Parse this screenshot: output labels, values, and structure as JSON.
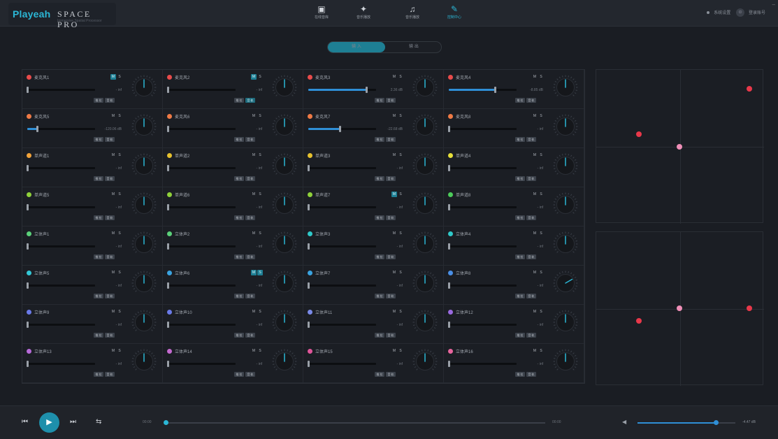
{
  "header": {
    "brand": "Playeah",
    "product": "SPACE  PRO",
    "tagline": "Immersive Spatial Processor",
    "nav": [
      {
        "label": "在线音库",
        "icon": "▣"
      },
      {
        "label": "音乐播放",
        "icon": "✦"
      },
      {
        "label": "音乐播放",
        "icon": "♫"
      },
      {
        "label": "控制中心",
        "icon": "✎"
      }
    ],
    "settings_label": "系统设置",
    "user_label": "登录账号",
    "minimize": "–"
  },
  "tabs": {
    "input": "输 入",
    "output": "输 出"
  },
  "channels": [
    {
      "name": "麦克风1",
      "color": "#e84b4b",
      "m": true,
      "s": false,
      "level": 0,
      "db": "- inf",
      "b1": false,
      "b2": false,
      "knob": 0
    },
    {
      "name": "麦克风2",
      "color": "#e84b4b",
      "m": true,
      "s": false,
      "level": 0,
      "db": "- inf",
      "b1": false,
      "b2": true,
      "knob": 0
    },
    {
      "name": "麦克风3",
      "color": "#e84b4b",
      "m": false,
      "s": false,
      "level": 0.86,
      "db": "2.36 dB",
      "b1": false,
      "b2": false,
      "knob": 0
    },
    {
      "name": "麦克风4",
      "color": "#e84b4b",
      "m": false,
      "s": false,
      "level": 0.68,
      "db": "-8.85 dB",
      "b1": false,
      "b2": false,
      "knob": 0
    },
    {
      "name": "麦克风5",
      "color": "#ef7a45",
      "m": false,
      "s": false,
      "level": 0.14,
      "db": "-120.06 dB",
      "b1": false,
      "b2": false,
      "knob": 0
    },
    {
      "name": "麦克风6",
      "color": "#ef7a45",
      "m": false,
      "s": false,
      "level": 0,
      "db": "- inf",
      "b1": false,
      "b2": false,
      "knob": 0
    },
    {
      "name": "麦克风7",
      "color": "#ef7a45",
      "m": false,
      "s": false,
      "level": 0.46,
      "db": "-22.68 dB",
      "b1": false,
      "b2": false,
      "knob": 0
    },
    {
      "name": "麦克风8",
      "color": "#ef7a45",
      "m": false,
      "s": false,
      "level": 0,
      "db": "- inf",
      "b1": false,
      "b2": false,
      "knob": 0
    },
    {
      "name": "单声道1",
      "color": "#f2a33a",
      "m": false,
      "s": false,
      "level": 0,
      "db": "- inf",
      "b1": false,
      "b2": false,
      "knob": 0
    },
    {
      "name": "单声道2",
      "color": "#e6c12f",
      "m": false,
      "s": false,
      "level": 0,
      "db": "- inf",
      "b1": false,
      "b2": false,
      "knob": 0
    },
    {
      "name": "单声道3",
      "color": "#e6c12f",
      "m": false,
      "s": false,
      "level": 0,
      "db": "- inf",
      "b1": false,
      "b2": false,
      "knob": 0
    },
    {
      "name": "单声道4",
      "color": "#e6df3a",
      "m": false,
      "s": false,
      "level": 0,
      "db": "- inf",
      "b1": false,
      "b2": false,
      "knob": 0
    },
    {
      "name": "单声道5",
      "color": "#8fd13a",
      "m": false,
      "s": false,
      "level": 0,
      "db": "- inf",
      "b1": false,
      "b2": false,
      "knob": 0
    },
    {
      "name": "单声道6",
      "color": "#8fd13a",
      "m": false,
      "s": false,
      "level": 0,
      "db": "- inf",
      "b1": false,
      "b2": false,
      "knob": 0
    },
    {
      "name": "单声道7",
      "color": "#8fd13a",
      "m": true,
      "s": false,
      "level": 0,
      "db": "- inf",
      "b1": false,
      "b2": false,
      "knob": 0
    },
    {
      "name": "单声道8",
      "color": "#4ccc5a",
      "m": false,
      "s": false,
      "level": 0,
      "db": "- inf",
      "b1": false,
      "b2": false,
      "knob": 0
    },
    {
      "name": "立体声1",
      "color": "#5bd07a",
      "m": false,
      "s": false,
      "level": 0,
      "db": "- inf",
      "b1": false,
      "b2": false,
      "knob": 0
    },
    {
      "name": "立体声2",
      "color": "#5bd07a",
      "m": false,
      "s": false,
      "level": 0,
      "db": "- inf",
      "b1": false,
      "b2": false,
      "knob": 0
    },
    {
      "name": "立体声3",
      "color": "#2fc9c9",
      "m": false,
      "s": false,
      "level": 0,
      "db": "- inf",
      "b1": false,
      "b2": false,
      "knob": 0
    },
    {
      "name": "立体声4",
      "color": "#2fc9c9",
      "m": false,
      "s": false,
      "level": 0,
      "db": "- inf",
      "b1": false,
      "b2": false,
      "knob": 0
    },
    {
      "name": "立体声5",
      "color": "#33c7d6",
      "m": false,
      "s": false,
      "level": 0,
      "db": "- inf",
      "b1": false,
      "b2": false,
      "knob": 0
    },
    {
      "name": "立体声6",
      "color": "#3aa3e0",
      "m": true,
      "s": true,
      "level": 0,
      "db": "- inf",
      "b1": false,
      "b2": false,
      "knob": 0
    },
    {
      "name": "立体声7",
      "color": "#3aa3e0",
      "m": false,
      "s": false,
      "level": 0,
      "db": "- inf",
      "b1": false,
      "b2": false,
      "knob": 0
    },
    {
      "name": "立体声8",
      "color": "#4a8fe6",
      "m": false,
      "s": false,
      "level": 0,
      "db": "- inf",
      "b1": false,
      "b2": false,
      "knob": 60
    },
    {
      "name": "立体声9",
      "color": "#6a7ae8",
      "m": false,
      "s": false,
      "level": 0,
      "db": "- inf",
      "b1": false,
      "b2": false,
      "knob": 0
    },
    {
      "name": "立体声10",
      "color": "#6a7ae8",
      "m": false,
      "s": false,
      "level": 0,
      "db": "- inf",
      "b1": false,
      "b2": false,
      "knob": 0
    },
    {
      "name": "立体声11",
      "color": "#7a8ae8",
      "m": false,
      "s": false,
      "level": 0,
      "db": "- inf",
      "b1": false,
      "b2": false,
      "knob": 0
    },
    {
      "name": "立体声12",
      "color": "#9a6ae0",
      "m": false,
      "s": false,
      "level": 0,
      "db": "- inf",
      "b1": false,
      "b2": false,
      "knob": 0
    },
    {
      "name": "立体声13",
      "color": "#b66ad8",
      "m": false,
      "s": false,
      "level": 0,
      "db": "- inf",
      "b1": false,
      "b2": false,
      "knob": 0
    },
    {
      "name": "立体声14",
      "color": "#c46ad0",
      "m": false,
      "s": false,
      "level": 0,
      "db": "- inf",
      "b1": false,
      "b2": false,
      "knob": 0
    },
    {
      "name": "立体声15",
      "color": "#e0559a",
      "m": false,
      "s": false,
      "level": 0,
      "db": "- inf",
      "b1": false,
      "b2": false,
      "knob": 0
    },
    {
      "name": "立体声16",
      "color": "#e8659e",
      "m": false,
      "s": false,
      "level": 0,
      "db": "- inf",
      "b1": false,
      "b2": false,
      "knob": 0
    }
  ],
  "channel_labels": {
    "m": "M",
    "s": "S",
    "b1": "推 拉",
    "b2": "音 轨"
  },
  "pan_colors": {
    "red": "#e8384a",
    "pink": "#f08fb8"
  },
  "player": {
    "time_start": "00:00",
    "time_end": "00:00",
    "progress": 0,
    "volume": 0.8,
    "volume_db": "-4.47 dB",
    "icons": {
      "prev": "⏮",
      "play": "▶",
      "next": "⏭",
      "loop": "⇆",
      "volume": "◀"
    }
  }
}
